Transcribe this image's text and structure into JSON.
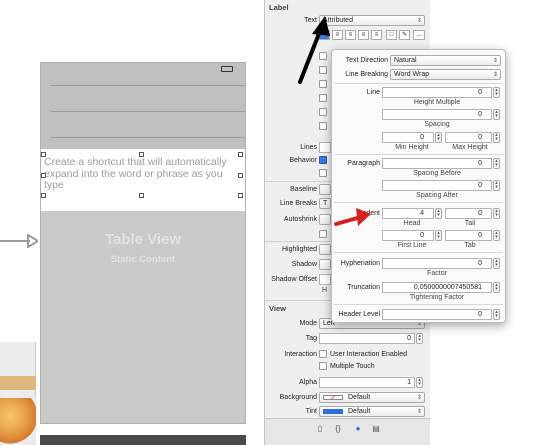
{
  "canvas": {
    "cell_text": "Create a shortcut that will automatically expand into the word or phrase as you type",
    "table_view_title": "Table View",
    "table_view_subtitle": "Static Content"
  },
  "inspector": {
    "label_section": "Label",
    "text_label": "Text",
    "text_value": "Attributed",
    "lines_label": "Lines",
    "behavior_label": "Behavior",
    "baseline_label": "Baseline",
    "line_breaks_label": "Line Breaks",
    "line_breaks_value": "T",
    "autoshrink_label": "Autoshrink",
    "highlighted_label": "Highlighted",
    "shadow_label": "Shadow",
    "shadow_offset_label": "Shadow Offset",
    "shadow_offset_sub": "H",
    "view_section": "View",
    "mode_label": "Mode",
    "mode_value": "Left",
    "tag_label": "Tag",
    "tag_value": "0",
    "interaction_label": "Interaction",
    "user_interaction": "User Interaction Enabled",
    "multiple_touch": "Multiple Touch",
    "alpha_label": "Alpha",
    "alpha_value": "1",
    "background_label": "Background",
    "background_value": "Default",
    "tint_label": "Tint",
    "tint_value": "Default",
    "more_button": "..."
  },
  "popover": {
    "text_direction_label": "Text Direction",
    "text_direction_value": "Natural",
    "line_breaking_label": "Line Breaking",
    "line_breaking_value": "Word Wrap",
    "line_label": "Line",
    "line_value": "0",
    "height_multiple": "Height Multiple",
    "spacing_value": "0",
    "spacing_label": "Spacing",
    "min_height_value": "0",
    "max_height_value": "0",
    "min_height_label": "Min Height",
    "max_height_label": "Max Height",
    "paragraph_label": "Paragraph",
    "paragraph_value": "0",
    "spacing_before": "Spacing Before",
    "spacing_after_value": "0",
    "spacing_after": "Spacing After",
    "indent_label": "Indent",
    "head_value": "4",
    "tail_value": "0",
    "head_label": "Head",
    "tail_label": "Tail",
    "first_line_value": "0",
    "tab_value": "0",
    "first_line_label": "First Line",
    "tab_label": "Tab",
    "hyphenation_label": "Hyphenation",
    "hyphenation_value": "0",
    "factor_label": "Factor",
    "truncation_label": "Truncation",
    "truncation_value": "0,0500000007450581",
    "tightening_label": "Tightening Factor",
    "header_level_label": "Header Level",
    "header_level_value": "0"
  },
  "colors": {
    "annotation_arrow_black": "#000000",
    "annotation_arrow_red": "#d42020",
    "tint_swatch": "#2f6fd6"
  },
  "icons": [
    "search-icon",
    "chevron-updown-icon",
    "align-left-icon",
    "align-center-icon",
    "align-right-icon",
    "align-justify-icon",
    "align-natural-icon",
    "frame-icon",
    "edit-icon",
    "file-tab-icon",
    "code-tab-icon",
    "object-tab-icon",
    "media-tab-icon"
  ]
}
